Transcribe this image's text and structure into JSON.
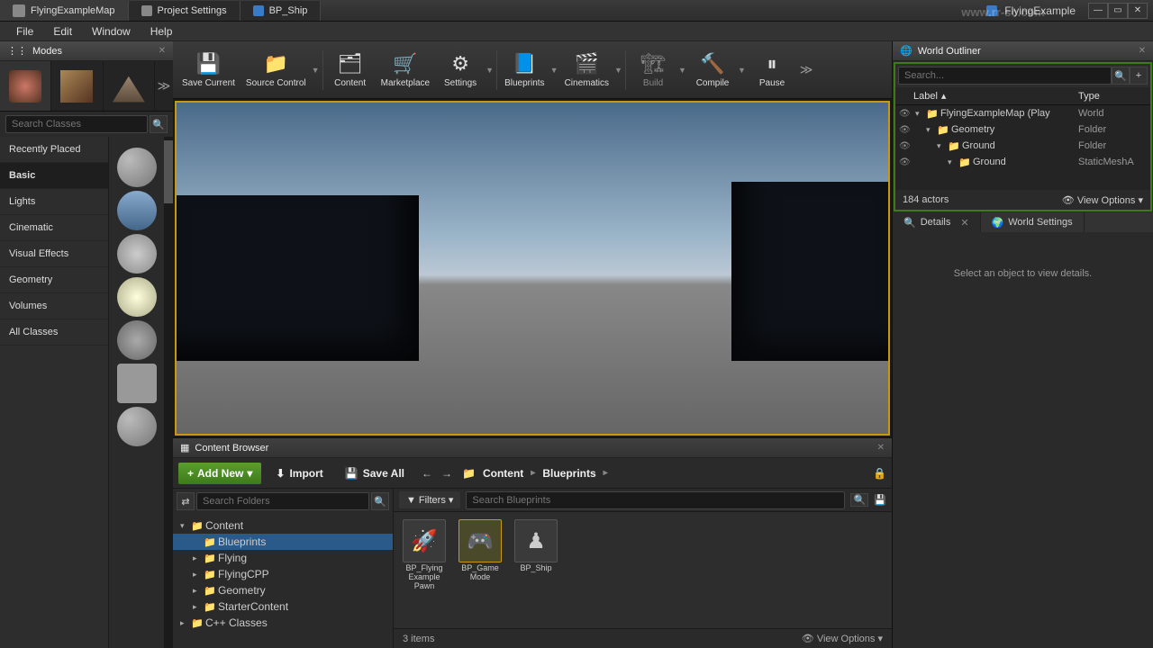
{
  "title": {
    "tabs": [
      {
        "label": "FlyingExampleMap",
        "active": true
      },
      {
        "label": "Project Settings"
      },
      {
        "label": "BP_Ship"
      }
    ],
    "project": "FlyingExample"
  },
  "watermark": "www.rr-sc.com",
  "menu": [
    "File",
    "Edit",
    "Window",
    "Help"
  ],
  "modes": {
    "title": "Modes",
    "search_placeholder": "Search Classes",
    "categories": [
      "Recently Placed",
      "Basic",
      "Lights",
      "Cinematic",
      "Visual Effects",
      "Geometry",
      "Volumes",
      "All Classes"
    ],
    "active_category": 1
  },
  "toolbar": [
    {
      "label": "Save Current",
      "icon": "💾"
    },
    {
      "label": "Source Control",
      "icon": "📁",
      "split": true
    },
    {
      "label": "Content",
      "icon": "🗂"
    },
    {
      "label": "Marketplace",
      "icon": "🛒"
    },
    {
      "label": "Settings",
      "icon": "⚙",
      "split": true
    },
    {
      "label": "Blueprints",
      "icon": "📘",
      "split": true
    },
    {
      "label": "Cinematics",
      "icon": "🎬",
      "split": true
    },
    {
      "label": "Build",
      "icon": "🏗",
      "split": true,
      "disabled": true
    },
    {
      "label": "Compile",
      "icon": "🔨",
      "split": true
    },
    {
      "label": "Pause",
      "icon": "⏸"
    }
  ],
  "content_browser": {
    "title": "Content Browser",
    "add_new": "Add New",
    "import": "Import",
    "save_all": "Save All",
    "breadcrumb": [
      "Content",
      "Blueprints"
    ],
    "filters": "Filters",
    "search_folders": "Search Folders",
    "search_assets": "Search Blueprints",
    "view_options": "View Options",
    "items_count": "3 items",
    "tree": [
      {
        "label": "Content",
        "depth": 0,
        "expanded": true
      },
      {
        "label": "Blueprints",
        "depth": 1,
        "selected": true
      },
      {
        "label": "Flying",
        "depth": 1,
        "collapsed": true
      },
      {
        "label": "FlyingCPP",
        "depth": 1,
        "collapsed": true
      },
      {
        "label": "Geometry",
        "depth": 1,
        "collapsed": true
      },
      {
        "label": "StarterContent",
        "depth": 1,
        "collapsed": true
      },
      {
        "label": "C++ Classes",
        "depth": 0,
        "collapsed": true
      }
    ],
    "assets": [
      {
        "label": "BP_Flying\nExample\nPawn"
      },
      {
        "label": "BP_Game\nMode",
        "selected": true
      },
      {
        "label": "BP_Ship"
      }
    ]
  },
  "outliner": {
    "title": "World Outliner",
    "search_placeholder": "Search...",
    "col_label": "Label",
    "col_type": "Type",
    "actors_count": "184 actors",
    "view_options": "View Options",
    "rows": [
      {
        "label": "FlyingExampleMap (Play",
        "type": "World",
        "depth": 0
      },
      {
        "label": "Geometry",
        "type": "Folder",
        "depth": 1
      },
      {
        "label": "Ground",
        "type": "Folder",
        "depth": 2
      },
      {
        "label": "Ground",
        "type": "StaticMeshA",
        "depth": 3
      }
    ]
  },
  "details": {
    "tab1": "Details",
    "tab2": "World Settings",
    "empty_msg": "Select an object to view details."
  }
}
